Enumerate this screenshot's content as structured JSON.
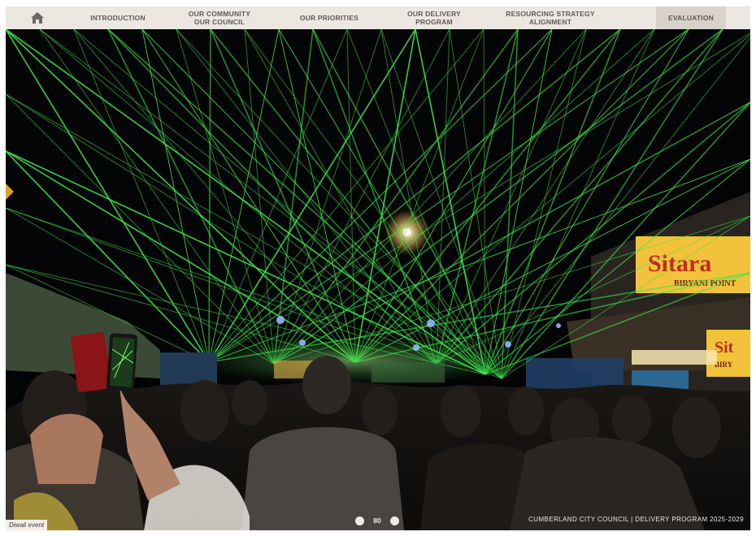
{
  "nav": {
    "home_icon": "home-icon",
    "items": [
      {
        "label": "INTRODUCTION"
      },
      {
        "label": "OUR COMMUNITY OUR COUNCIL"
      },
      {
        "label": "OUR PRIORITIES"
      },
      {
        "label": "OUR DELIVERY PROGRAM"
      },
      {
        "label": "RESOURCING STRATEGY ALIGNMENT"
      },
      {
        "label": "EVALUATION"
      }
    ],
    "active": "EVALUATION"
  },
  "photo": {
    "caption": "Diwali event",
    "signs": {
      "sitara": "Sitara",
      "biryani_point": "BIRYANI POINT",
      "sitara_small": "Sit",
      "biryani_small": "BIRY"
    }
  },
  "footer": {
    "page_number": "80",
    "organisation": "CUMBERLAND CITY COUNCIL | DELIVERY PROGRAM 2025-2029"
  },
  "colors": {
    "nav_bg": "#ece7e1",
    "laser": "#3fe34a",
    "sign_yellow": "#f2c23a"
  }
}
